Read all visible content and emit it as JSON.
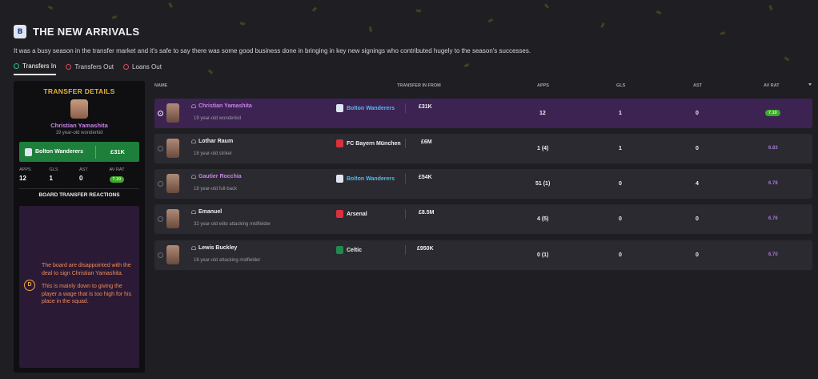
{
  "header": {
    "title": "THE NEW ARRIVALS",
    "badge_icon": "bolton-wanderers-crest"
  },
  "intro": "It was a busy season in the transfer market and it's safe to say there was some good business done in bringing in key new signings who contributed hugely to the season's successes.",
  "tabs": [
    {
      "label": "Transfers In",
      "active": true
    },
    {
      "label": "Transfers Out",
      "active": false
    },
    {
      "label": "Loans Out",
      "active": false
    }
  ],
  "details": {
    "title": "TRANSFER DETAILS",
    "name": "Christian Yamashita",
    "desc": "19 year-old wonderkid",
    "club": "Bolton Wanderers",
    "fee": "£31K",
    "stat_labels": {
      "apps": "APPS",
      "gls": "GLS",
      "ast": "AST",
      "avrat": "AV RAT"
    },
    "apps": "12",
    "gls": "1",
    "ast": "0",
    "rating": "7.10",
    "reactions_title": "BOARD TRANSFER REACTIONS",
    "grade": "D",
    "reaction_1": "The board are disappointed with the deal to sign Christian Yamashita.",
    "reaction_2": "This is mainly down to giving the player a wage that is too high for his place in the squad."
  },
  "columns": {
    "name": "NAME",
    "from": "TRANSFER IN FROM",
    "apps": "APPS",
    "gls": "GLS",
    "ast": "AST",
    "avrat": "AV RAT"
  },
  "rows": [
    {
      "name": "Christian Yamashita",
      "desc": "19 year-old wonderkid",
      "club": "Bolton Wanderers",
      "fee": "£31K",
      "apps": "12",
      "gls": "1",
      "ast": "0",
      "rating": "7.10"
    },
    {
      "name": "Lothar Raum",
      "desc": "18 year-old striker",
      "club": "FC Bayern München",
      "fee": "£6M",
      "apps": "1 (4)",
      "gls": "1",
      "ast": "0",
      "rating": "6.83"
    },
    {
      "name": "Gautier Rocchia",
      "desc": "18 year-old full-back",
      "club": "Bolton Wanderers",
      "fee": "£54K",
      "apps": "51 (1)",
      "gls": "0",
      "ast": "4",
      "rating": "6.78"
    },
    {
      "name": "Emanuel",
      "desc": "32 year-old elite attacking midfielder",
      "club": "Arsenal",
      "fee": "£8.5M",
      "apps": "4 (5)",
      "gls": "0",
      "ast": "0",
      "rating": "6.76"
    },
    {
      "name": "Lewis Buckley",
      "desc": "16 year-old attacking midfielder",
      "club": "Celtic",
      "fee": "£950K",
      "apps": "0 (1)",
      "gls": "0",
      "ast": "0",
      "rating": "6.70"
    }
  ],
  "colors": {
    "accent_purple": "#c883e8",
    "gold": "#e2b13c",
    "green": "#1d7f3a",
    "rating_green": "#3da82e",
    "club_blue": "#57b8ea"
  }
}
